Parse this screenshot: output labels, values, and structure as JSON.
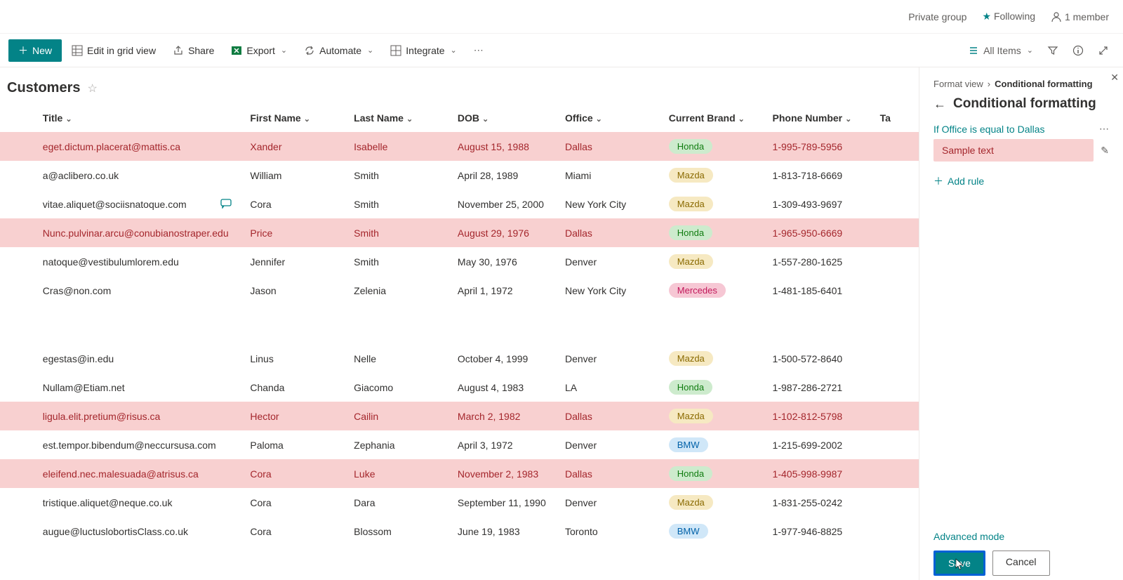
{
  "header": {
    "private_group": "Private group",
    "following": "Following",
    "members": "1 member"
  },
  "cmdbar": {
    "new": "New",
    "edit_grid": "Edit in grid view",
    "share": "Share",
    "export": "Export",
    "automate": "Automate",
    "integrate": "Integrate",
    "all_items": "All Items"
  },
  "list": {
    "title": "Customers",
    "columns": {
      "title": "Title",
      "first_name": "First Name",
      "last_name": "Last Name",
      "dob": "DOB",
      "office": "Office",
      "brand": "Current Brand",
      "phone": "Phone Number",
      "ta": "Ta"
    },
    "rows": [
      {
        "title": "eget.dictum.placerat@mattis.ca",
        "fn": "Xander",
        "ln": "Isabelle",
        "dob": "August 15, 1988",
        "off": "Dallas",
        "brand": "Honda",
        "brandClass": "honda",
        "phone": "1-995-789-5956",
        "hi": true
      },
      {
        "title": "a@aclibero.co.uk",
        "fn": "William",
        "ln": "Smith",
        "dob": "April 28, 1989",
        "off": "Miami",
        "brand": "Mazda",
        "brandClass": "mazda",
        "phone": "1-813-718-6669",
        "hi": false
      },
      {
        "title": "vitae.aliquet@sociisnatoque.com",
        "fn": "Cora",
        "ln": "Smith",
        "dob": "November 25, 2000",
        "off": "New York City",
        "brand": "Mazda",
        "brandClass": "mazda",
        "phone": "1-309-493-9697",
        "hi": false,
        "comment": true
      },
      {
        "title": "Nunc.pulvinar.arcu@conubianostraper.edu",
        "fn": "Price",
        "ln": "Smith",
        "dob": "August 29, 1976",
        "off": "Dallas",
        "brand": "Honda",
        "brandClass": "honda",
        "phone": "1-965-950-6669",
        "hi": true
      },
      {
        "title": "natoque@vestibulumlorem.edu",
        "fn": "Jennifer",
        "ln": "Smith",
        "dob": "May 30, 1976",
        "off": "Denver",
        "brand": "Mazda",
        "brandClass": "mazda",
        "phone": "1-557-280-1625",
        "hi": false
      },
      {
        "title": "Cras@non.com",
        "fn": "Jason",
        "ln": "Zelenia",
        "dob": "April 1, 1972",
        "off": "New York City",
        "brand": "Mercedes",
        "brandClass": "mercedes",
        "phone": "1-481-185-6401",
        "hi": false
      },
      {
        "gap": true
      },
      {
        "title": "egestas@in.edu",
        "fn": "Linus",
        "ln": "Nelle",
        "dob": "October 4, 1999",
        "off": "Denver",
        "brand": "Mazda",
        "brandClass": "mazda",
        "phone": "1-500-572-8640",
        "hi": false
      },
      {
        "title": "Nullam@Etiam.net",
        "fn": "Chanda",
        "ln": "Giacomo",
        "dob": "August 4, 1983",
        "off": "LA",
        "brand": "Honda",
        "brandClass": "honda",
        "phone": "1-987-286-2721",
        "hi": false
      },
      {
        "title": "ligula.elit.pretium@risus.ca",
        "fn": "Hector",
        "ln": "Cailin",
        "dob": "March 2, 1982",
        "off": "Dallas",
        "brand": "Mazda",
        "brandClass": "mazda",
        "phone": "1-102-812-5798",
        "hi": true
      },
      {
        "title": "est.tempor.bibendum@neccursusa.com",
        "fn": "Paloma",
        "ln": "Zephania",
        "dob": "April 3, 1972",
        "off": "Denver",
        "brand": "BMW",
        "brandClass": "bmw",
        "phone": "1-215-699-2002",
        "hi": false
      },
      {
        "title": "eleifend.nec.malesuada@atrisus.ca",
        "fn": "Cora",
        "ln": "Luke",
        "dob": "November 2, 1983",
        "off": "Dallas",
        "brand": "Honda",
        "brandClass": "honda",
        "phone": "1-405-998-9987",
        "hi": true
      },
      {
        "title": "tristique.aliquet@neque.co.uk",
        "fn": "Cora",
        "ln": "Dara",
        "dob": "September 11, 1990",
        "off": "Denver",
        "brand": "Mazda",
        "brandClass": "mazda",
        "phone": "1-831-255-0242",
        "hi": false
      },
      {
        "title": "augue@luctuslobortisClass.co.uk",
        "fn": "Cora",
        "ln": "Blossom",
        "dob": "June 19, 1983",
        "off": "Toronto",
        "brand": "BMW",
        "brandClass": "bmw",
        "phone": "1-977-946-8825",
        "hi": false
      }
    ]
  },
  "panel": {
    "breadcrumb_root": "Format view",
    "breadcrumb_cur": "Conditional formatting",
    "title": "Conditional formatting",
    "rule_label": "If Office is equal to Dallas",
    "sample_text": "Sample text",
    "add_rule": "Add rule",
    "advanced": "Advanced mode",
    "save": "Save",
    "cancel": "Cancel"
  }
}
